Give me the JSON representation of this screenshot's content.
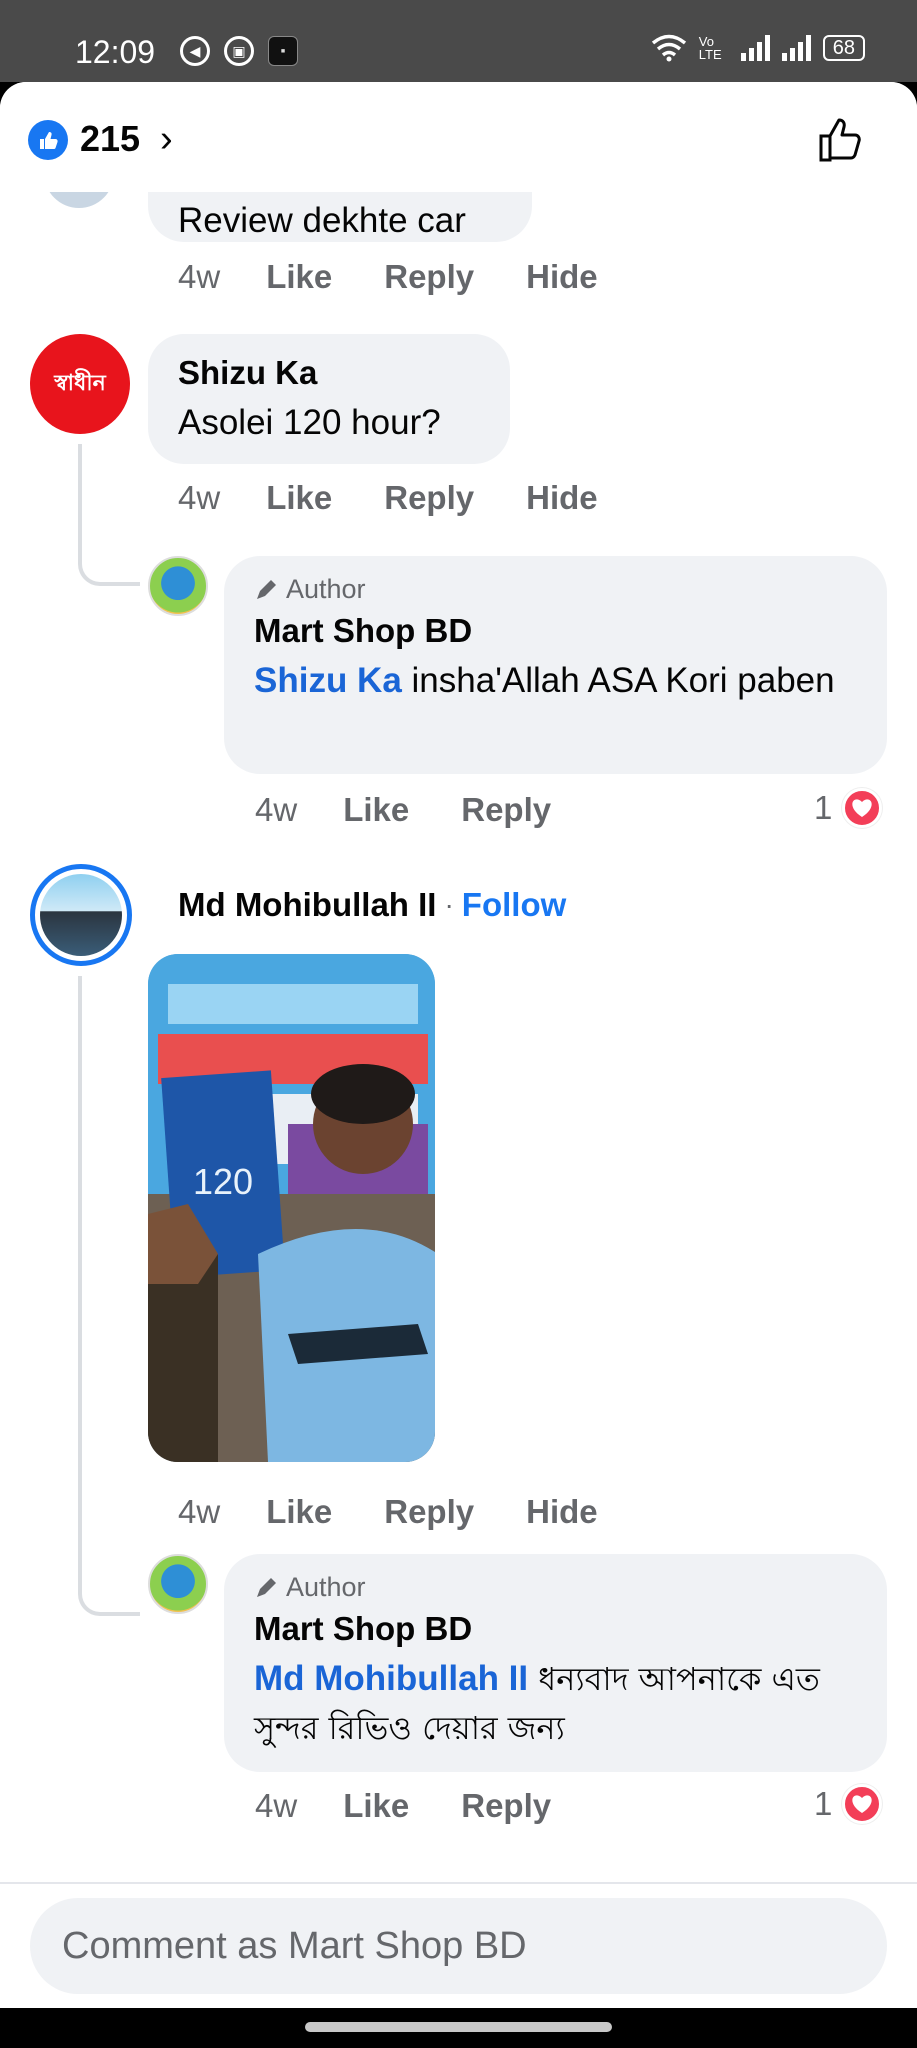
{
  "status_bar": {
    "time": "12:09",
    "network_label": "Vo LTE",
    "battery": "68"
  },
  "header": {
    "reaction_count": "215",
    "chevron": "›"
  },
  "comments": [
    {
      "id": "c0",
      "text_partial": "Review dekhte car",
      "time": "4w",
      "like": "Like",
      "reply": "Reply",
      "hide": "Hide"
    },
    {
      "id": "c1",
      "name": "Shizu Ka",
      "avatar_text": "স্বাধীন",
      "text": "Asolei 120 hour?",
      "time": "4w",
      "like": "Like",
      "reply": "Reply",
      "hide": "Hide",
      "reply_item": {
        "tag": "Author",
        "name": "Mart Shop BD",
        "mention": "Shizu Ka",
        "text": " insha'Allah ASA Kori paben",
        "time": "4w",
        "like": "Like",
        "reply": "Reply",
        "reaction_count": "1"
      }
    },
    {
      "id": "c2",
      "name": "Md Mohibullah II",
      "separator": "·",
      "follow": "Follow",
      "time": "4w",
      "like": "Like",
      "reply": "Reply",
      "hide": "Hide",
      "reply_item": {
        "tag": "Author",
        "name": "Mart Shop BD",
        "mention": "Md Mohibullah II",
        "text": " ধন্যবাদ আপনাকে এত সুন্দর রিভিও দেয়ার জন্য",
        "time": "4w",
        "like": "Like",
        "reply": "Reply",
        "reaction_count": "1"
      }
    }
  ],
  "composer": {
    "placeholder": "Comment as Mart Shop BD"
  },
  "colors": {
    "brand_blue": "#1877f2",
    "mention_blue": "#1a65d6",
    "heart_red": "#f33e58",
    "bubble_gray": "#f0f2f5"
  }
}
